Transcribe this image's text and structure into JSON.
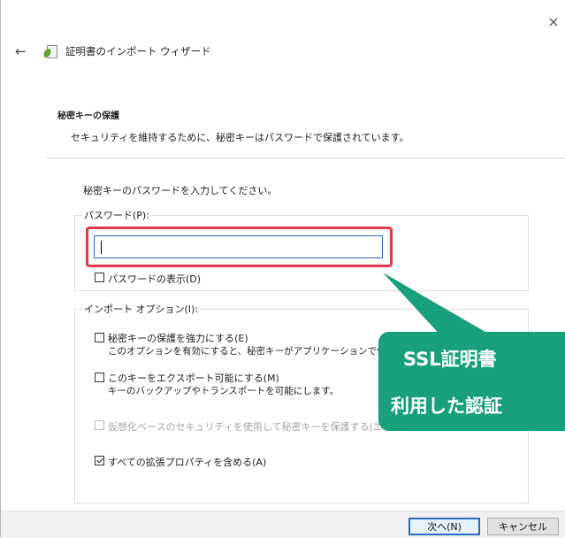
{
  "window": {
    "close_glyph": "×",
    "title": "証明書のインポート ウィザード"
  },
  "section": {
    "heading": "秘密キーの保護",
    "description": "セキュリティを維持するために、秘密キーはパスワードで保護されています。",
    "instruction": "秘密キーのパスワードを入力してください。"
  },
  "password": {
    "legend": "パスワード(P):",
    "value": "",
    "show_label": "パスワードの表示(D)",
    "show_checked": false
  },
  "options": {
    "legend": "インポート オプション(I):",
    "items": [
      {
        "label": "秘密キーの保護を強力にする(E)",
        "sub": "このオプションを有効にすると、秘密キーがアプリケーションで使わ",
        "checked": false,
        "disabled": false
      },
      {
        "label": "このキーをエクスポート可能にする(M)",
        "sub": "キーのバックアップやトランスポートを可能にします。",
        "checked": false,
        "disabled": false
      },
      {
        "label": "仮想化ベースのセキュリティを使用して秘密キーを保護する(エクス",
        "checked": false,
        "disabled": true
      },
      {
        "label": "すべての拡張プロパティを含める(A)",
        "checked": true,
        "disabled": false
      }
    ]
  },
  "footer": {
    "next_label": "次へ(N)",
    "cancel_label": "キャンセル"
  },
  "callout": {
    "line1": "SSL証明書",
    "line2": "利用した認証",
    "color": "#18a07c"
  },
  "highlight_color": "#e2384f",
  "icons": {
    "back": "back-arrow-icon",
    "certificate": "certificate-icon",
    "close": "close-icon"
  }
}
